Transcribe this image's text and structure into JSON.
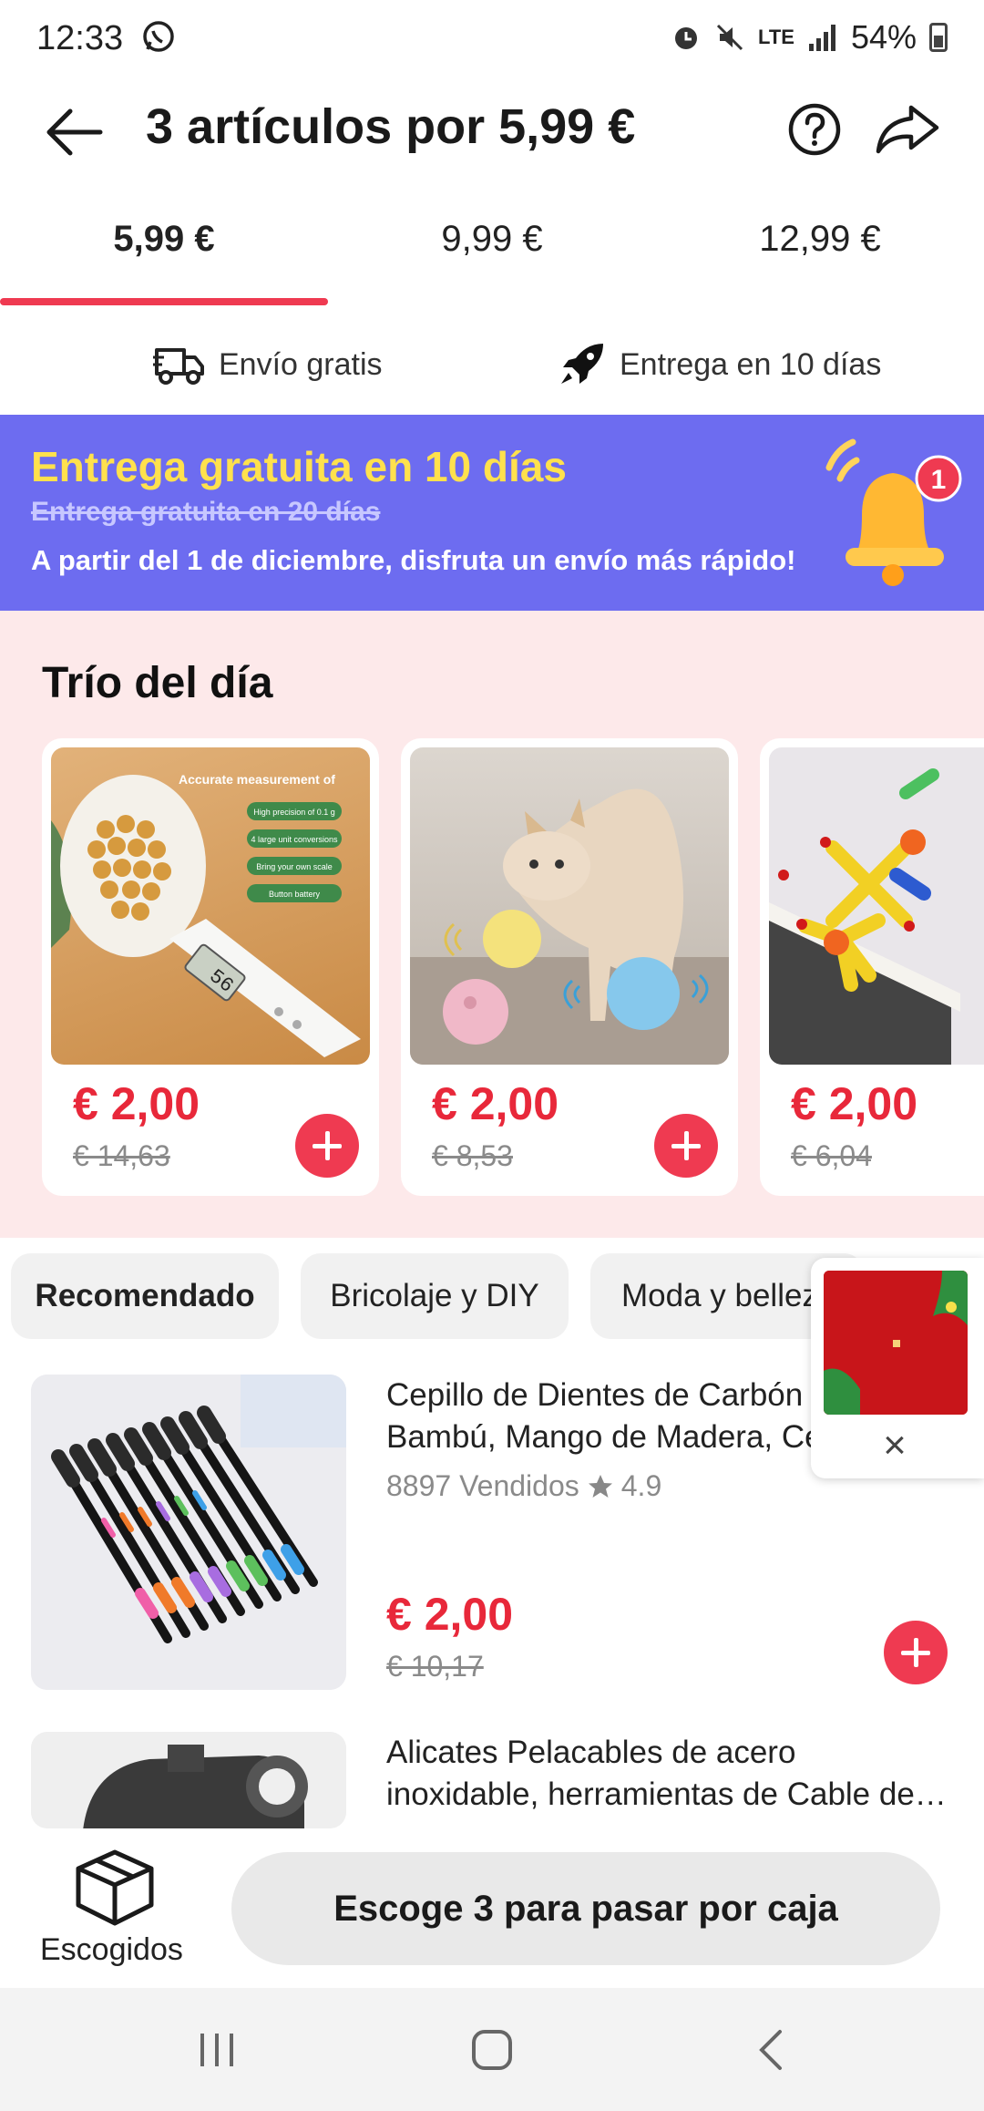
{
  "status_bar": {
    "time": "12:33",
    "battery": "54%",
    "network": "LTE"
  },
  "header": {
    "title": "3 artículos por  5,99 €"
  },
  "tabs": [
    {
      "label": "5,99 €",
      "active": true
    },
    {
      "label": "9,99 €",
      "active": false
    },
    {
      "label": "12,99 €",
      "active": false
    }
  ],
  "perks": {
    "free_shipping": "Envío gratis",
    "delivery": "Entrega en 10 días"
  },
  "banner": {
    "title": "Entrega gratuita en 10 días",
    "old_offer": "Entrega gratuita en 20 días",
    "subtitle": "A partir del 1 de diciembre, disfruta un envío más rápido!",
    "badge_count": "1"
  },
  "trio": {
    "title": "Trío del día",
    "items": [
      {
        "price": "€ 2,00",
        "old_price": "€ 14,63",
        "image_text": [
          "Accurate measurement of",
          "High precision of 0.1 g",
          "4 large unit conversions",
          "Bring your own scale",
          "Button battery"
        ],
        "display": "56"
      },
      {
        "price": "€ 2,00",
        "old_price": "€ 8,53"
      },
      {
        "price": "€ 2,00",
        "old_price": "€ 6,04"
      }
    ]
  },
  "categories": [
    {
      "label": "Recomendado",
      "active": true
    },
    {
      "label": "Bricolaje y DIY",
      "active": false
    },
    {
      "label": "Moda y belleza",
      "active": false
    }
  ],
  "products": [
    {
      "name": "Cepillo de Dientes de Carbón de Bambú, Mango de Madera, Cerdas",
      "sold": "8897 Vendidos",
      "rating": "4.9",
      "price": "€ 2,00",
      "old_price": "€ 10,17"
    },
    {
      "name": "Alicates Pelacables de acero inoxidable, herramientas de Cable de…",
      "sold": "",
      "rating": "",
      "price": "",
      "old_price": ""
    }
  ],
  "bottom_bar": {
    "picked_label": "Escogidos",
    "checkout_label": "Escoge 3 para pasar por caja"
  },
  "colors": {
    "accent": "#ef3a51",
    "price": "#e8283a",
    "banner_bg": "#6d6cf0",
    "banner_title": "#ffe14d",
    "trio_bg": "#fde9ea"
  },
  "icons": [
    "back-arrow-icon",
    "help-icon",
    "share-icon",
    "truck-icon",
    "rocket-icon",
    "bell-icon",
    "plus-icon",
    "star-icon",
    "box-icon",
    "close-icon",
    "nav-recents-icon",
    "nav-home-icon",
    "nav-back-icon"
  ]
}
